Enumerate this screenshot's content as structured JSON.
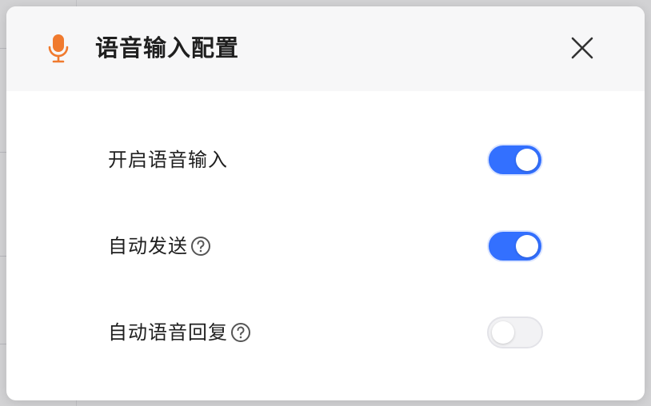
{
  "dialog": {
    "title": "语音输入配置",
    "title_icon": "microphone-icon",
    "close_icon": "close-icon",
    "accent_color": "#f07a2e"
  },
  "settings": [
    {
      "label": "开启语音输入",
      "has_help": false,
      "enabled": true
    },
    {
      "label": "自动发送",
      "has_help": true,
      "enabled": true
    },
    {
      "label": "自动语音回复",
      "has_help": true,
      "enabled": false
    }
  ],
  "colors": {
    "toggle_on": "#3370ff",
    "toggle_off": "#f2f2f4",
    "header_bg": "#f7f7f8"
  }
}
